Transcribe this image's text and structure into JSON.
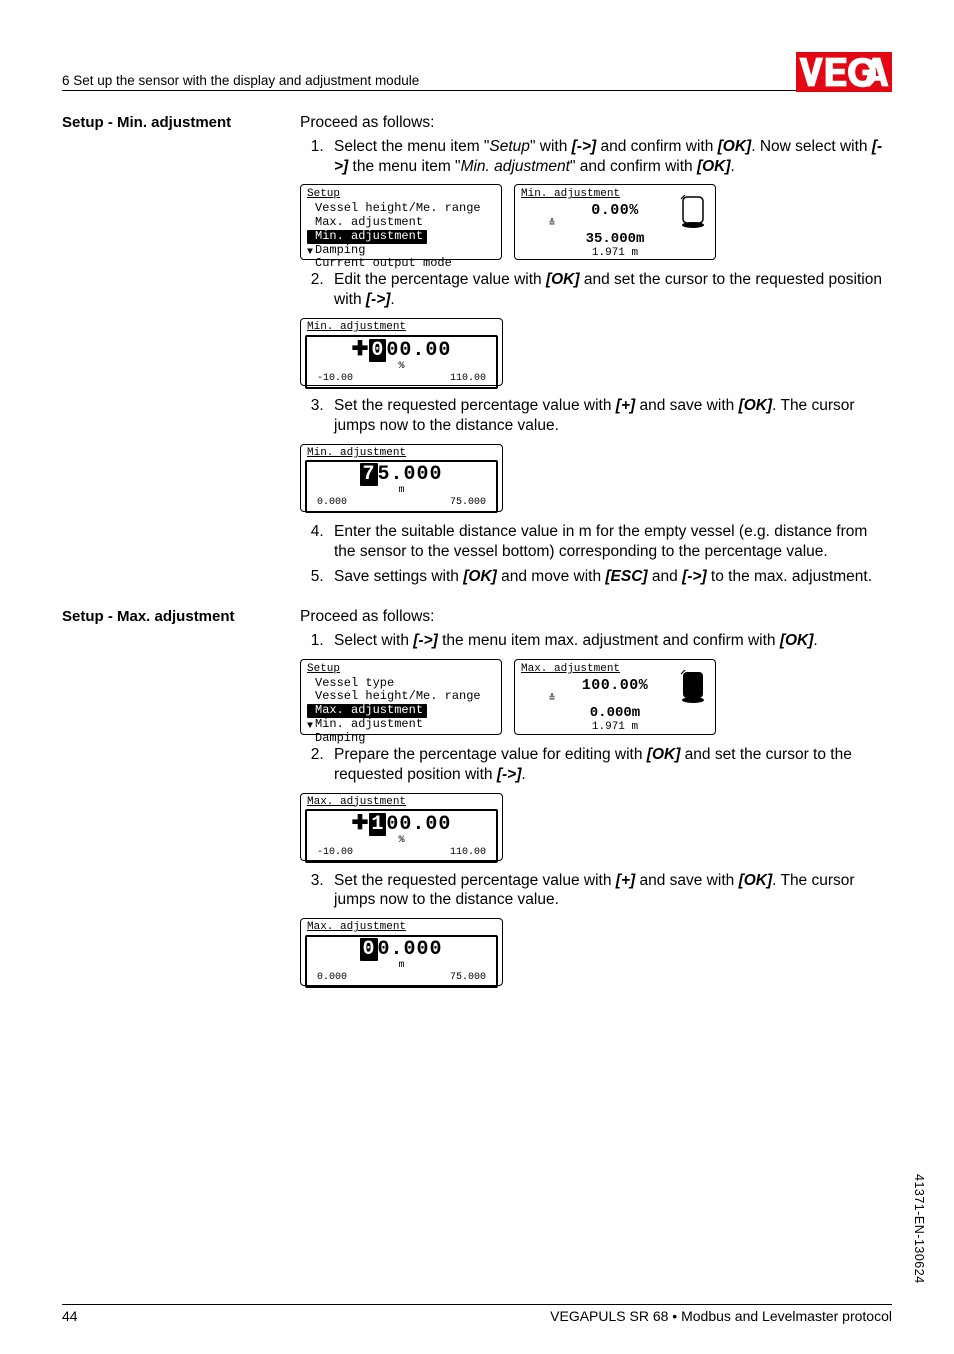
{
  "header": {
    "section_title": "6 Set up the sensor with the display and adjustment module"
  },
  "sections": [
    {
      "side_label": "Setup - Min. adjustment",
      "intro": "Proceed as follows:",
      "steps": [
        {
          "n": 1,
          "pre": "Select the menu item \"",
          "italic1": "Setup",
          "mid1": "\" with ",
          "bold1": "[->]",
          "mid2": " and confirm with ",
          "bold2": "[OK]",
          "mid3": ". Now select with ",
          "bold3": "[->]",
          "mid4": " the menu item \"",
          "italic2": "Min. adjustment",
          "mid5": "\" and confirm with ",
          "bold4": "[OK]",
          "post": "."
        },
        {
          "n": 2,
          "pre": "Edit the percentage value with ",
          "bold1": "[OK]",
          "mid1": " and set the cursor to the requested position with ",
          "bold2": "[->]",
          "post": "."
        },
        {
          "n": 3,
          "pre": "Set the requested percentage value with ",
          "bold1": "[+]",
          "mid1": " and save with ",
          "bold2": "[OK]",
          "post": ". The cursor jumps now to the distance value."
        },
        {
          "n": 4,
          "text": "Enter the suitable distance value in m for the empty vessel (e.g. distance from the sensor to the vessel bottom) corresponding to the percentage value."
        },
        {
          "n": 5,
          "pre": "Save settings with ",
          "bold1": "[OK]",
          "mid1": " and move with ",
          "bold2": "[ESC]",
          "mid2": " and ",
          "bold3": "[->]",
          "post": " to the max. adjustment."
        }
      ],
      "menu_screen": {
        "title": "Setup",
        "items": [
          "Vessel height/Me. range",
          "Max. adjustment",
          "Min. adjustment",
          "Damping",
          "Current output mode"
        ],
        "selected_index": 2
      },
      "value_screen": {
        "title": "Min. adjustment",
        "percent": "0.00%",
        "dist": "35.000m",
        "small": "1.971 m",
        "tank_fill": "empty"
      },
      "edit_screens": [
        {
          "title": "Min. adjustment",
          "digit_cursor": "0",
          "digits_rest": "00.00",
          "prefix_icon": "plus",
          "unit": "%",
          "scale_left": "-10.00",
          "scale_right": "110.00"
        },
        {
          "title": "Min. adjustment",
          "digit_cursor": "7",
          "digits_rest": "5.000",
          "prefix_icon": "none",
          "unit": "m",
          "scale_left": "0.000",
          "scale_right": "75.000"
        }
      ]
    },
    {
      "side_label": "Setup - Max. adjustment",
      "intro": "Proceed as follows:",
      "steps": [
        {
          "n": 1,
          "pre": "Select with ",
          "bold1": "[->]",
          "mid1": " the menu item max. adjustment and confirm with ",
          "bold2": "[OK]",
          "post": "."
        },
        {
          "n": 2,
          "pre": "Prepare the percentage value for editing with ",
          "bold1": "[OK]",
          "mid1": " and set the cursor to the requested position with ",
          "bold2": "[->]",
          "post": "."
        },
        {
          "n": 3,
          "pre": "Set the requested percentage value with ",
          "bold1": "[+]",
          "mid1": " and save with ",
          "bold2": "[OK]",
          "post": ". The cursor jumps now to the distance value."
        }
      ],
      "menu_screen": {
        "title": "Setup",
        "items": [
          "Vessel type",
          "Vessel height/Me. range",
          "Max. adjustment",
          "Min. adjustment",
          "Damping"
        ],
        "selected_index": 2
      },
      "value_screen": {
        "title": "Max. adjustment",
        "percent": "100.00%",
        "dist": "0.000m",
        "small": "1.971 m",
        "tank_fill": "full"
      },
      "edit_screens": [
        {
          "title": "Max. adjustment",
          "digit_cursor": "1",
          "digits_rest": "00.00",
          "prefix_icon": "plus",
          "unit": "%",
          "scale_left": "-10.00",
          "scale_right": "110.00"
        },
        {
          "title": "Max. adjustment",
          "digit_cursor": "0",
          "digits_rest": "0.000",
          "prefix_icon": "none",
          "unit": "m",
          "scale_left": "0.000",
          "scale_right": "75.000"
        }
      ]
    }
  ],
  "footer": {
    "page_number": "44",
    "doc_title": "VEGAPULS SR 68 • Modbus and Levelmaster protocol"
  },
  "side_code": "41371-EN-130624"
}
